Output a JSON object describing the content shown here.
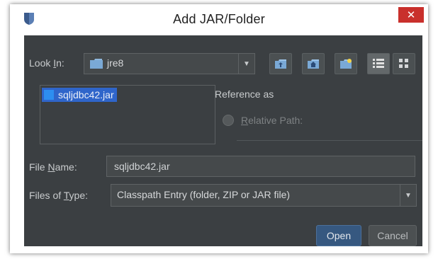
{
  "window": {
    "title": "Add JAR/Folder",
    "close_glyph": "✕"
  },
  "look_in": {
    "label_prefix": "Look ",
    "label_mnemonic": "I",
    "label_suffix": "n:",
    "value": "jre8",
    "icon": "folder-icon"
  },
  "toolbar": [
    {
      "name": "up-one-level-button",
      "icon": "folder-up-icon"
    },
    {
      "name": "home-button",
      "icon": "home-icon"
    },
    {
      "name": "new-folder-button",
      "icon": "new-folder-icon"
    },
    {
      "name": "list-view-button",
      "icon": "list-view-icon",
      "active": true
    },
    {
      "name": "details-view-button",
      "icon": "details-view-icon"
    }
  ],
  "file_list": [
    {
      "name": "sqljdbc42.jar",
      "selected": true,
      "icon": "jar-file-icon"
    }
  ],
  "reference": {
    "title": "Reference as",
    "option_mnemonic": "R",
    "option_rest": "elative Path:"
  },
  "file_name": {
    "label_prefix": "File ",
    "label_mnemonic": "N",
    "label_suffix": "ame:",
    "value": "sqljdbc42.jar"
  },
  "files_of_type": {
    "label_prefix": "Files of ",
    "label_mnemonic": "T",
    "label_suffix": "ype:",
    "value": "Classpath Entry (folder, ZIP or JAR file)"
  },
  "buttons": {
    "open": "Open",
    "cancel": "Cancel"
  },
  "colors": {
    "background": "#3b3f42",
    "selection": "#2f65ca",
    "open_button": "#365880",
    "close_button": "#c9302c"
  }
}
